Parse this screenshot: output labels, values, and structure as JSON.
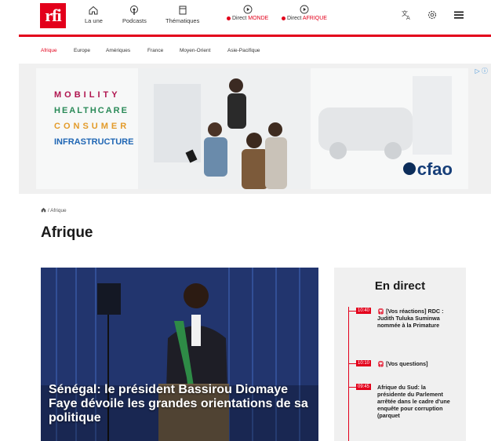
{
  "header": {
    "logo": "rfi",
    "nav": [
      {
        "label": "La une",
        "icon": "home-icon"
      },
      {
        "label": "Podcasts",
        "icon": "podcast-icon"
      },
      {
        "label": "Thématiques",
        "icon": "bookmark-icon"
      }
    ],
    "live": [
      {
        "prefix": "Direct",
        "name": "MONDE",
        "icon": "play-circle-icon"
      },
      {
        "prefix": "Direct",
        "name": "AFRIQUE",
        "icon": "play-circle-icon"
      }
    ],
    "tools": [
      "translate-icon",
      "gear-icon",
      "menu-icon"
    ]
  },
  "subnav": [
    "Afrique",
    "Europe",
    "Amériques",
    "France",
    "Moyen-Orient",
    "Asie-Pacifique"
  ],
  "ad": {
    "words": [
      "MOBILITY",
      "HEALTHCARE",
      "CONSUMER",
      "INFRASTRUCTURE"
    ],
    "brand": "cfao",
    "choice": "▷ ⓘ"
  },
  "breadcrumb": {
    "home_icon": "home-icon",
    "sep": "/",
    "current": "Afrique"
  },
  "page_title": "Afrique",
  "hero": {
    "headline": "Sénégal: le président Bassirou Diomaye Faye dévoile les grandes orientations de sa politique"
  },
  "live_panel": {
    "title": "En direct",
    "items": [
      {
        "time": "10:40",
        "headphone": true,
        "text": "[Vos réactions] RDC : Judith Tuluka Suminwa nommée à la Primature"
      },
      {
        "time": "10:10",
        "headphone": true,
        "text": "[Vos questions]"
      },
      {
        "time": "09:45",
        "headphone": false,
        "text": "Afrique du Sud: la présidente du Parlement arrêtée dans le cadre d'une enquête pour corruption (parquet"
      }
    ]
  },
  "colors": {
    "brand_red": "#e3001b",
    "ad_navy": "#173f79"
  }
}
